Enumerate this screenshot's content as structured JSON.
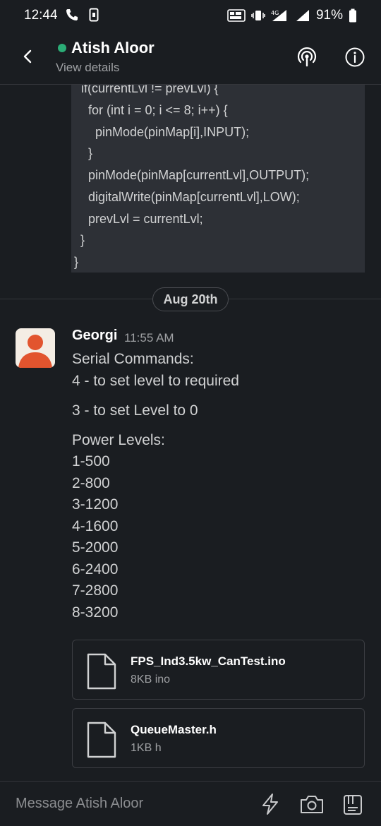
{
  "status_bar": {
    "time": "12:44",
    "battery": "91%"
  },
  "header": {
    "channel_name": "Atish Aloor",
    "subtitle": "View details",
    "presence_color": "#2bac76"
  },
  "code_block": {
    "lines": [
      "if(currentLvl != prevLvl) {",
      "  for (int i = 0; i <= 8; i++) {",
      "    pinMode(pinMap[i],INPUT);",
      "  }",
      "  pinMode(pinMap[currentLvl],OUTPUT);",
      "  digitalWrite(pinMap[currentLvl],LOW);",
      "  prevLvl = currentLvl;",
      " }",
      "}"
    ]
  },
  "date_divider": "Aug 20th",
  "message": {
    "author": "Georgi",
    "time": "11:55 AM",
    "lines": [
      "Serial Commands:",
      "4 - to set level to required",
      "3 - to set Level to 0",
      "Power Levels:",
      "1-500",
      "2-800",
      "3-1200",
      "4-1600",
      "5-2000",
      "6-2400",
      "7-2800",
      "8-3200"
    ],
    "attachments": [
      {
        "name": "FPS_Ind3.5kw_CanTest.ino",
        "meta": "8KB ino"
      },
      {
        "name": "QueueMaster.h",
        "meta": "1KB h"
      }
    ]
  },
  "composer": {
    "placeholder": "Message Atish Aloor"
  },
  "colors": {
    "background": "#1a1d21",
    "code_background": "#2d3036",
    "avatar_accent": "#e2542e"
  }
}
